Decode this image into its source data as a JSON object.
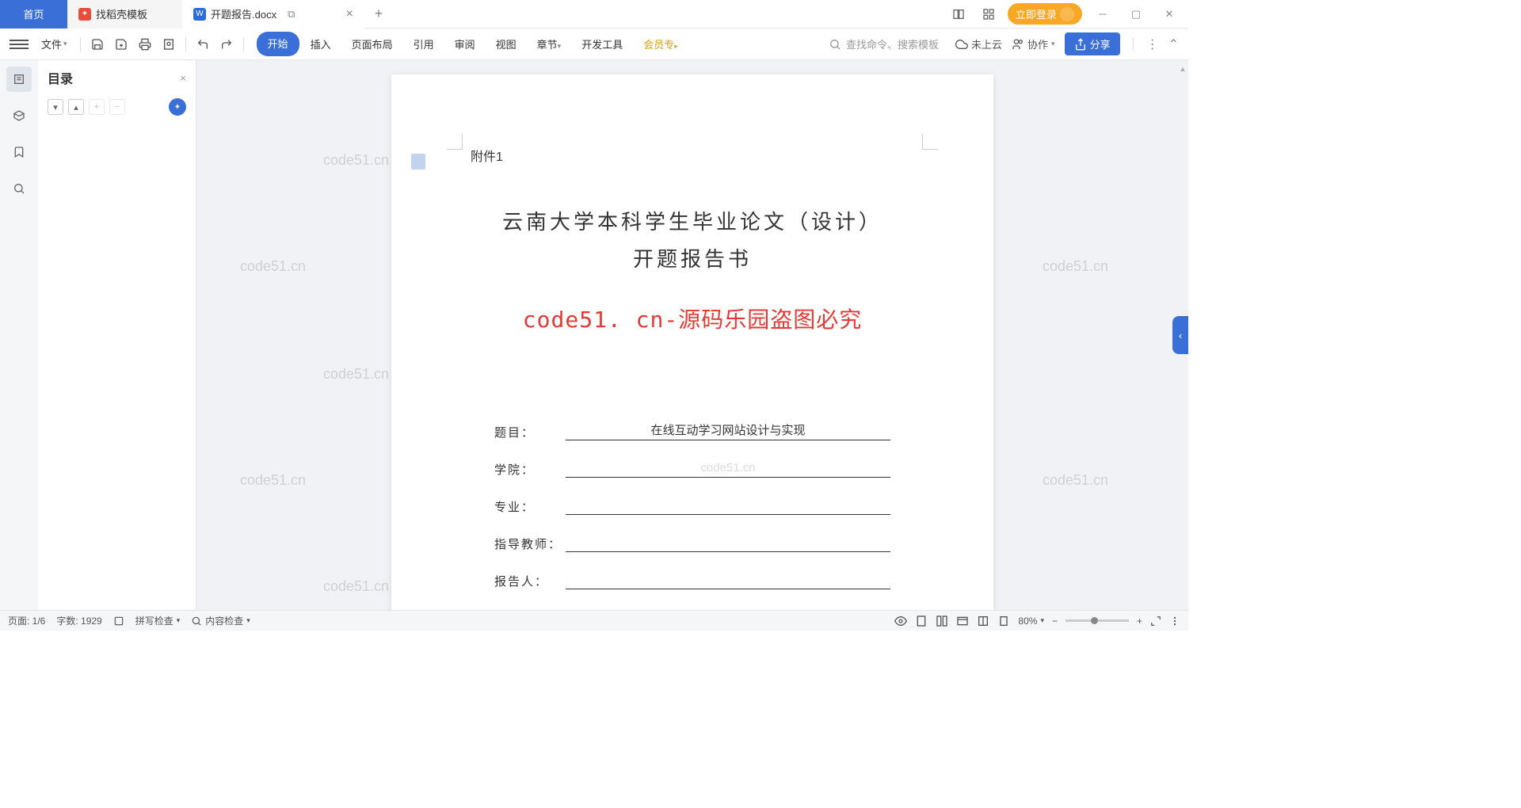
{
  "titlebar": {
    "home_tab": "首页",
    "template_tab": "找稻壳模板",
    "doc_tab": "开题报告.docx",
    "login": "立即登录"
  },
  "ribbon": {
    "file": "文件",
    "tabs": {
      "start": "开始",
      "insert": "插入",
      "layout": "页面布局",
      "reference": "引用",
      "review": "审阅",
      "view": "视图",
      "chapter": "章节",
      "devtools": "开发工具",
      "member": "会员专"
    },
    "search_placeholder": "查找命令、搜索模板",
    "cloud": "未上云",
    "collab": "协作",
    "share": "分享"
  },
  "toc": {
    "title": "目录"
  },
  "document": {
    "attachment": "附件1",
    "title_line1": "云南大学本科学生毕业论文（设计）",
    "title_line2": "开题报告书",
    "watermark_red": "code51. cn-源码乐园盗图必究",
    "form": {
      "topic_label": "题目：",
      "topic_value": "在线互动学习网站设计与实现",
      "college_label": "学院：",
      "major_label": "专业：",
      "advisor_label": "指导教师：",
      "reporter_label": "报告人："
    },
    "wm_text": "code51.cn"
  },
  "statusbar": {
    "page": "页面: 1/6",
    "words": "字数: 1929",
    "spellcheck": "拼写检查",
    "content_check": "内容检查",
    "zoom": "80%"
  }
}
